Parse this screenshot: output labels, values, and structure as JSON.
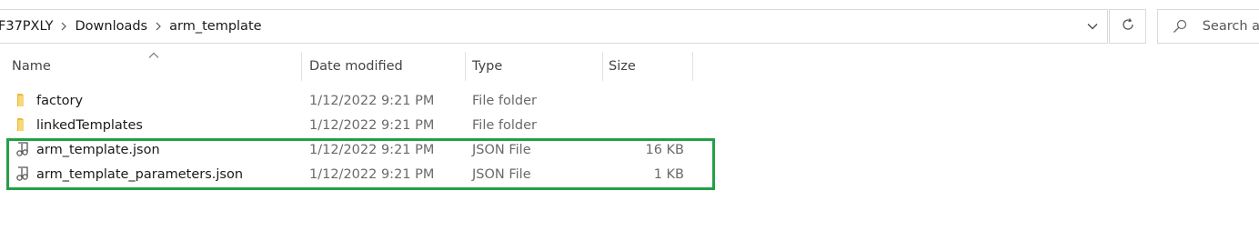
{
  "address_bar": {
    "crumbs": [
      "F37PXLY",
      "Downloads",
      "arm_template"
    ]
  },
  "search": {
    "placeholder": "Search ar"
  },
  "columns": {
    "name": "Name",
    "date_modified": "Date modified",
    "type": "Type",
    "size": "Size"
  },
  "rows": [
    {
      "name": "factory",
      "date": "1/12/2022 9:21 PM",
      "type": "File folder",
      "size": "",
      "icon": "folder-icon"
    },
    {
      "name": "linkedTemplates",
      "date": "1/12/2022 9:21 PM",
      "type": "File folder",
      "size": "",
      "icon": "folder-icon"
    },
    {
      "name": "arm_template.json",
      "date": "1/12/2022 9:21 PM",
      "type": "JSON File",
      "size": "16 KB",
      "icon": "json-file-icon"
    },
    {
      "name": "arm_template_parameters.json",
      "date": "1/12/2022 9:21 PM",
      "type": "JSON File",
      "size": "1 KB",
      "icon": "json-file-icon"
    }
  ],
  "colors": {
    "highlight": "#23a046",
    "folder": "#f8d775",
    "border": "#d9d9d9"
  }
}
